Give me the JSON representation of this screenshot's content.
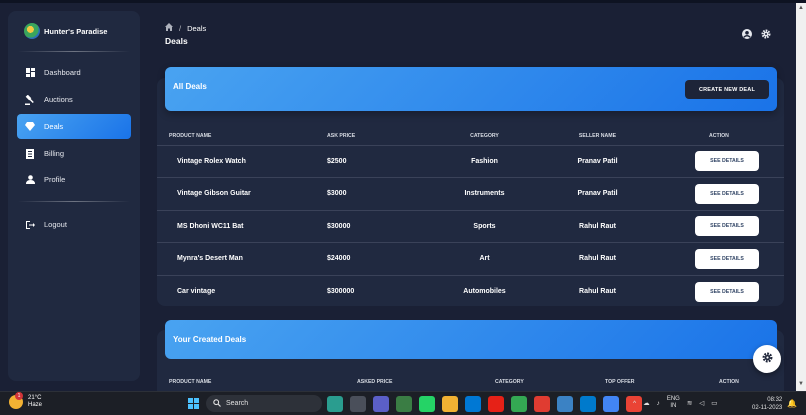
{
  "app": {
    "brand": "Hunter's Paradise"
  },
  "sidebar": {
    "items": [
      {
        "label": "Dashboard",
        "icon": "dashboard-icon"
      },
      {
        "label": "Auctions",
        "icon": "gavel-icon"
      },
      {
        "label": "Deals",
        "icon": "diamond-icon",
        "active": true
      },
      {
        "label": "Billing",
        "icon": "receipt-icon"
      },
      {
        "label": "Profile",
        "icon": "person-icon"
      }
    ],
    "logout": "Logout"
  },
  "header": {
    "breadcrumb": "Deals",
    "title": "Deals"
  },
  "all_deals": {
    "title": "All Deals",
    "create_button": "CREATE NEW DEAL",
    "columns": [
      "PRODUCT NAME",
      "ASK PRICE",
      "CATEGORY",
      "SELLER NAME",
      "ACTION"
    ],
    "rows": [
      {
        "product": "Vintage Rolex Watch",
        "price": "$2500",
        "category": "Fashion",
        "seller": "Pranav Patil",
        "action": "SEE DETAILS"
      },
      {
        "product": "Vintage Gibson Guitar",
        "price": "$3000",
        "category": "Instruments",
        "seller": "Pranav Patil",
        "action": "SEE DETAILS"
      },
      {
        "product": "MS Dhoni WC11 Bat",
        "price": "$30000",
        "category": "Sports",
        "seller": "Rahul Raut",
        "action": "SEE DETAILS"
      },
      {
        "product": "Mynra's Desert Man",
        "price": "$24000",
        "category": "Art",
        "seller": "Rahul Raut",
        "action": "SEE DETAILS"
      },
      {
        "product": "Car vintage",
        "price": "$300000",
        "category": "Automobiles",
        "seller": "Rahul Raut",
        "action": "SEE DETAILS"
      }
    ]
  },
  "created_deals": {
    "title": "Your Created Deals",
    "columns": [
      "PRODUCT NAME",
      "ASKED PRICE",
      "CATEGORY",
      "TOP OFFER",
      "ACTION"
    ]
  },
  "taskbar": {
    "temperature": "21°C",
    "weather": "Haze",
    "weather_badge": "1",
    "search_placeholder": "Search",
    "lang_line1": "ENG",
    "lang_line2": "IN",
    "time": "08:32",
    "date": "02-11-2023"
  },
  "colors": {
    "accent": "#1a73e8",
    "background": "#1a2035",
    "card": "#202940"
  }
}
